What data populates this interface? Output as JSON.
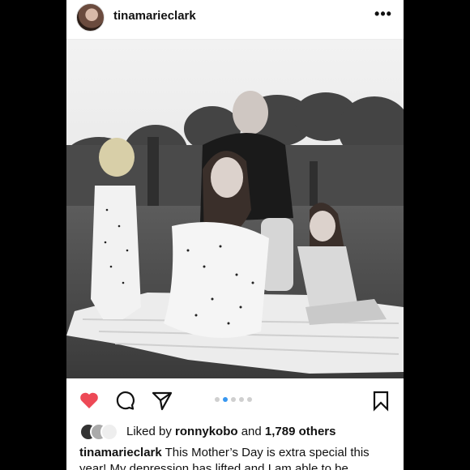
{
  "post": {
    "username": "tinamarieclark",
    "avatar_icon": "profile-avatar",
    "more_icon": "more-horizontal-icon",
    "more_glyph": "•••",
    "carousel": {
      "count": 5,
      "active_index": 1
    },
    "liked": true,
    "likes": {
      "prefix": "Liked by",
      "user": "ronnykobo",
      "joiner": "and",
      "others": "1,789 others"
    },
    "caption": {
      "username": "tinamarieclark",
      "text": "This Mother’s Day is extra special this year! My depression has lifted and I am able to be"
    }
  },
  "colors": {
    "like_red": "#ed4956",
    "carousel_active": "#3897f0",
    "carousel_inactive": "#cfcfcf"
  }
}
